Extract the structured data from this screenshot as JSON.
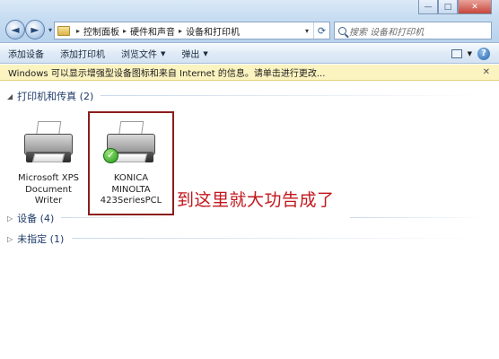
{
  "window": {
    "minimize": "—",
    "maximize": "□",
    "close": "✕"
  },
  "nav": {
    "back": "◄",
    "forward": "►",
    "dropdown": "▾"
  },
  "address": {
    "crumbs": [
      "控制面板",
      "硬件和声音",
      "设备和打印机"
    ],
    "separator": "▸"
  },
  "search": {
    "placeholder": "搜索 设备和打印机"
  },
  "commandbar": {
    "add_device": "添加设备",
    "add_printer": "添加打印机",
    "browse_files": "浏览文件",
    "eject": "弹出"
  },
  "infobar": {
    "text": "Windows 可以显示增强型设备图标和来自 Internet 的信息。请单击进行更改...",
    "close": "✕"
  },
  "groups": {
    "printers": {
      "label": "打印机和传真 (2)"
    },
    "devices": {
      "label": "设备 (4)"
    },
    "unspecified": {
      "label": "未指定 (1)"
    }
  },
  "printers": [
    {
      "line1": "Microsoft XPS",
      "line2": "Document",
      "line3": "Writer",
      "default": false
    },
    {
      "line1": "KONICA",
      "line2": "MINOLTA",
      "line3": "423SeriesPCL",
      "default": true
    }
  ],
  "annotation": "到这里就大功告成了",
  "colors": {
    "annotation": "#c2161c",
    "selection_box": "#8b1d1d",
    "infobar_bg": "#fbf3c0"
  }
}
